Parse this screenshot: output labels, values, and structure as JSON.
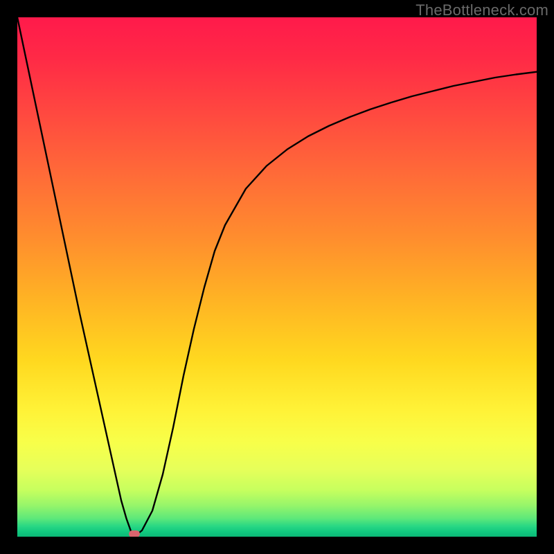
{
  "watermark": "TheBottleneck.com",
  "chart_data": {
    "type": "line",
    "title": "",
    "xlabel": "",
    "ylabel": "",
    "xlim": [
      0,
      100
    ],
    "ylim": [
      0,
      100
    ],
    "grid": false,
    "series": [
      {
        "name": "curve",
        "x": [
          0,
          2,
          4,
          6,
          8,
          10,
          12,
          14,
          16,
          18,
          20,
          21,
          22,
          23,
          24,
          26,
          28,
          30,
          32,
          34,
          36,
          38,
          40,
          44,
          48,
          52,
          56,
          60,
          64,
          68,
          72,
          76,
          80,
          84,
          88,
          92,
          96,
          100
        ],
        "y": [
          100,
          90.5,
          81,
          71.5,
          62,
          52.5,
          43,
          34,
          25,
          16,
          7,
          3.5,
          0.7,
          0.4,
          1.2,
          5,
          12,
          21,
          31,
          40,
          48,
          55,
          60,
          67,
          71.4,
          74.6,
          77.1,
          79.1,
          80.8,
          82.3,
          83.6,
          84.8,
          85.8,
          86.8,
          87.6,
          88.4,
          89.0,
          89.5
        ]
      }
    ],
    "marker": {
      "x": 22.5,
      "y": 0.5
    },
    "background_gradient": {
      "top": "#ff1a4b",
      "bottom": "#0bb877"
    }
  }
}
